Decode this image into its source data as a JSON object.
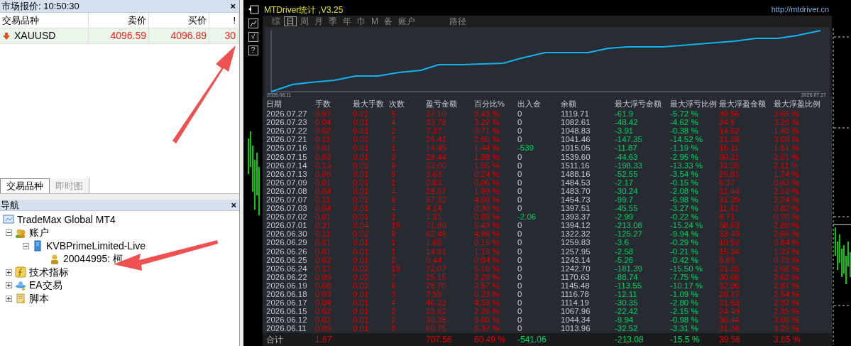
{
  "market_watch": {
    "title": "市场报价: 10:50:30",
    "close": "×",
    "columns": [
      "交易品种",
      "卖价",
      "买价",
      "!"
    ],
    "rows": [
      {
        "symbol": "XAUUSD",
        "bid": "4096.59",
        "ask": "4096.89",
        "spread": "30"
      }
    ],
    "tabs": [
      {
        "label": "交易品种",
        "selected": true
      },
      {
        "label": "即时图",
        "selected": false
      }
    ]
  },
  "navigator": {
    "title": "导航",
    "close": "×",
    "tree": [
      {
        "label": "TradeMax Global MT4",
        "kind": "platform",
        "children": [
          {
            "label": "账户",
            "kind": "accounts",
            "expanded": true,
            "children": [
              {
                "label": "KVBPrimeLimited-Live",
                "kind": "server",
                "expanded": true,
                "children": [
                  {
                    "label": "20044995: 柯",
                    "kind": "account"
                  }
                ]
              }
            ]
          },
          {
            "label": "技术指标",
            "kind": "indicators",
            "expanded": false
          },
          {
            "label": "EA交易",
            "kind": "experts",
            "expanded": false
          },
          {
            "label": "脚本",
            "kind": "scripts",
            "expanded": false
          }
        ]
      }
    ]
  },
  "side_tools": [
    "√",
    "?"
  ],
  "stats_window": {
    "title": "MTDriver统计 ,V3.25",
    "url": "http://mtdriver.cn",
    "tabs": [
      {
        "label": "综",
        "selected": false
      },
      {
        "label": "日",
        "selected": true
      },
      {
        "label": "周",
        "selected": false
      },
      {
        "label": "月",
        "selected": false
      },
      {
        "label": "季",
        "selected": false
      },
      {
        "label": "年",
        "selected": false
      },
      {
        "label": "巾",
        "selected": false
      },
      {
        "label": "M",
        "selected": false
      },
      {
        "label": "备",
        "selected": false
      },
      {
        "label": "账户",
        "selected": false
      },
      {
        "label": "路径",
        "selected": false
      }
    ],
    "chart": {
      "start_label": "2026.06.11",
      "end_label": "2026.07.27"
    },
    "columns": [
      {
        "label": "日期",
        "kind": "plain"
      },
      {
        "label": "手数",
        "kind": "red"
      },
      {
        "label": "最大手数",
        "kind": "red"
      },
      {
        "label": "次数",
        "kind": "red"
      },
      {
        "label": "盈亏金额",
        "kind": "red"
      },
      {
        "label": "百分比%",
        "kind": "red"
      },
      {
        "label": "出入金",
        "kind": "flow"
      },
      {
        "label": "余额",
        "kind": "plain"
      },
      {
        "label": "最大浮亏金额",
        "kind": "green"
      },
      {
        "label": "最大浮亏比例",
        "kind": "green"
      },
      {
        "label": "最大浮盈金额",
        "kind": "red"
      },
      {
        "label": "最大浮盈比例",
        "kind": "red"
      }
    ],
    "rows": [
      {
        "cells": [
          "2026.07.27",
          "0.07",
          "0.02",
          "5",
          "37.10",
          "3.43 %",
          "0",
          "1119.71",
          "-61.9",
          "-5.72 %",
          "39.56",
          "3.65 %"
        ],
        "cash_flow": false
      },
      {
        "cells": [
          "2026.07.23",
          "0.04",
          "0.01",
          "4",
          "33.78",
          "3.22 %",
          "0",
          "1082.61",
          "-48.42",
          "-4.62 %",
          "34.5",
          "3.29 %"
        ],
        "cash_flow": false
      },
      {
        "cells": [
          "2026.07.22",
          "0.02",
          "0.01",
          "2",
          "7.37",
          "0.71 %",
          "0",
          "1048.83",
          "-3.91",
          "-0.38 %",
          "14.62",
          "1.40 %"
        ],
        "cash_flow": false
      },
      {
        "cells": [
          "2026.07.21",
          "0.11",
          "0.02",
          "7",
          "26.41",
          "2.60 %",
          "0",
          "1041.46",
          "-147.35",
          "-14.52 %",
          "31.35",
          "3.09 %"
        ],
        "cash_flow": false
      },
      {
        "cells": [
          "2026.07.16",
          "0.01",
          "0.01",
          "1",
          "14.45",
          "1.44 %",
          "-539",
          "1015.05",
          "-11.87",
          "-1.19 %",
          "15.11",
          "1.51 %"
        ],
        "cash_flow": true
      },
      {
        "cells": [
          "2026.07.15",
          "0.03",
          "0.01",
          "3",
          "28.44",
          "1.88 %",
          "0",
          "1539.60",
          "-44.63",
          "-2.95 %",
          "30.31",
          "2.01 %"
        ],
        "cash_flow": false
      },
      {
        "cells": [
          "2026.07.14",
          "0.13",
          "0.02",
          "9",
          "23.00",
          "1.55 %",
          "0",
          "1511.16",
          "-198.33",
          "-13.33 %",
          "31.35",
          "2.11 %"
        ],
        "cash_flow": false
      },
      {
        "cells": [
          "2026.07.13",
          "0.05",
          "0.01",
          "5",
          "3.63",
          "0.24 %",
          "0",
          "1488.16",
          "-52.55",
          "-3.54 %",
          "25.81",
          "1.74 %"
        ],
        "cash_flow": false
      },
      {
        "cells": [
          "2026.07.09",
          "0.01",
          "0.01",
          "1",
          "0.83",
          "0.06 %",
          "0",
          "1484.53",
          "-2.17",
          "-0.15 %",
          "9.37",
          "0.63 %"
        ],
        "cash_flow": false
      },
      {
        "cells": [
          "2026.07.08",
          "0.04",
          "0.01",
          "4",
          "28.97",
          "1.99 %",
          "0",
          "1483.70",
          "-30.24",
          "-2.08 %",
          "31.44",
          "2.16 %"
        ],
        "cash_flow": false
      },
      {
        "cells": [
          "2026.07.07",
          "0.11",
          "0.02",
          "9",
          "57.22",
          "4.09 %",
          "0",
          "1454.73",
          "-99.7",
          "-6.98 %",
          "31.39",
          "2.24 %"
        ],
        "cash_flow": false
      },
      {
        "cells": [
          "2026.07.03",
          "0.04",
          "0.01",
          "4",
          "4.14",
          "0.30 %",
          "0",
          "1397.51",
          "-45.55",
          "-3.27 %",
          "11.41",
          "0.82 %"
        ],
        "cash_flow": false
      },
      {
        "cells": [
          "2026.07.02",
          "0.01",
          "0.01",
          "1",
          "1.31",
          "0.09 %",
          "-2.06",
          "1393.37",
          "-2.99",
          "-0.22 %",
          "9.71",
          "0.70 %"
        ],
        "cash_flow": true
      },
      {
        "cells": [
          "2026.07.01",
          "0.31",
          "0.04",
          "19",
          "71.80",
          "5.43 %",
          "0",
          "1394.12",
          "-213.08",
          "-15.24 %",
          "38.93",
          "2.88 %"
        ],
        "cash_flow": false
      },
      {
        "cells": [
          "2026.06.30",
          "0.11",
          "0.02",
          "9",
          "62.49",
          "4.96 %",
          "0",
          "1322.32",
          "-125.27",
          "-9.94 %",
          "33.49",
          "2.66 %"
        ],
        "cash_flow": false
      },
      {
        "cells": [
          "2026.06.29",
          "0.01",
          "0.01",
          "1",
          "1.88",
          "0.15 %",
          "0",
          "1259.83",
          "-3.6",
          "-0.29 %",
          "10.52",
          "0.84 %"
        ],
        "cash_flow": false
      },
      {
        "cells": [
          "2026.06.26",
          "0.01",
          "0.01",
          "1",
          "14.81",
          "1.19 %",
          "0",
          "1257.95",
          "-2.58",
          "-0.21 %",
          "15.34",
          "1.23 %"
        ],
        "cash_flow": false
      },
      {
        "cells": [
          "2026.06.25",
          "0.02",
          "0.01",
          "2",
          "0.44",
          "0.04 %",
          "0",
          "1243.14",
          "-5.26",
          "-0.42 %",
          "9.83",
          "0.79 %"
        ],
        "cash_flow": false
      },
      {
        "cells": [
          "2026.06.24",
          "0.17",
          "0.02",
          "13",
          "72.07",
          "6.16 %",
          "0",
          "1242.70",
          "-181.39",
          "-15.50 %",
          "31.35",
          "2.68 %"
        ],
        "cash_flow": false
      },
      {
        "cells": [
          "2026.06.22",
          "0.09",
          "0.02",
          "7",
          "25.15",
          "2.20 %",
          "0",
          "1170.63",
          "-88.74",
          "-7.75 %",
          "30.05",
          "2.62 %"
        ],
        "cash_flow": false
      },
      {
        "cells": [
          "2026.06.19",
          "0.08",
          "0.02",
          "6",
          "28.70",
          "2.57 %",
          "0",
          "1145.48",
          "-113.55",
          "-10.17 %",
          "32.05",
          "2.87 %"
        ],
        "cash_flow": false
      },
      {
        "cells": [
          "2026.06.18",
          "0.03",
          "0.01",
          "3",
          "2.59",
          "0.23 %",
          "0",
          "1116.78",
          "-12.11",
          "-1.09 %",
          "28.27",
          "2.54 %"
        ],
        "cash_flow": false
      },
      {
        "cells": [
          "2026.06.17",
          "0.04",
          "0.01",
          "4",
          "46.23",
          "4.33 %",
          "0",
          "1114.19",
          "-30.35",
          "-2.80 %",
          "31.63",
          "2.92 %"
        ],
        "cash_flow": false
      },
      {
        "cells": [
          "2026.06.15",
          "0.02",
          "0.01",
          "2",
          "23.62",
          "2.26 %",
          "0",
          "1067.96",
          "-22.42",
          "-2.15 %",
          "24.49",
          "2.35 %"
        ],
        "cash_flow": false
      },
      {
        "cells": [
          "2026.06.12",
          "0.02",
          "0.01",
          "2",
          "30.38",
          "3.00 %",
          "0",
          "1044.34",
          "-9.94",
          "-0.98 %",
          "30.44",
          "3.00 %"
        ],
        "cash_flow": false
      },
      {
        "cells": [
          "2026.06.11",
          "0.09",
          "0.01",
          "9",
          "60.75",
          "6.37 %",
          "0",
          "1013.96",
          "-32.52",
          "-3.31 %",
          "31.36",
          "3.25 %"
        ],
        "cash_flow": false
      }
    ],
    "totals": {
      "cells": [
        "合计",
        "1.67",
        null,
        null,
        "707.56",
        "60.49 %",
        "-541.06",
        null,
        "-213.08",
        "-15.5 %",
        "39.56",
        "3.65 %"
      ],
      "cash_flow": true
    }
  }
}
